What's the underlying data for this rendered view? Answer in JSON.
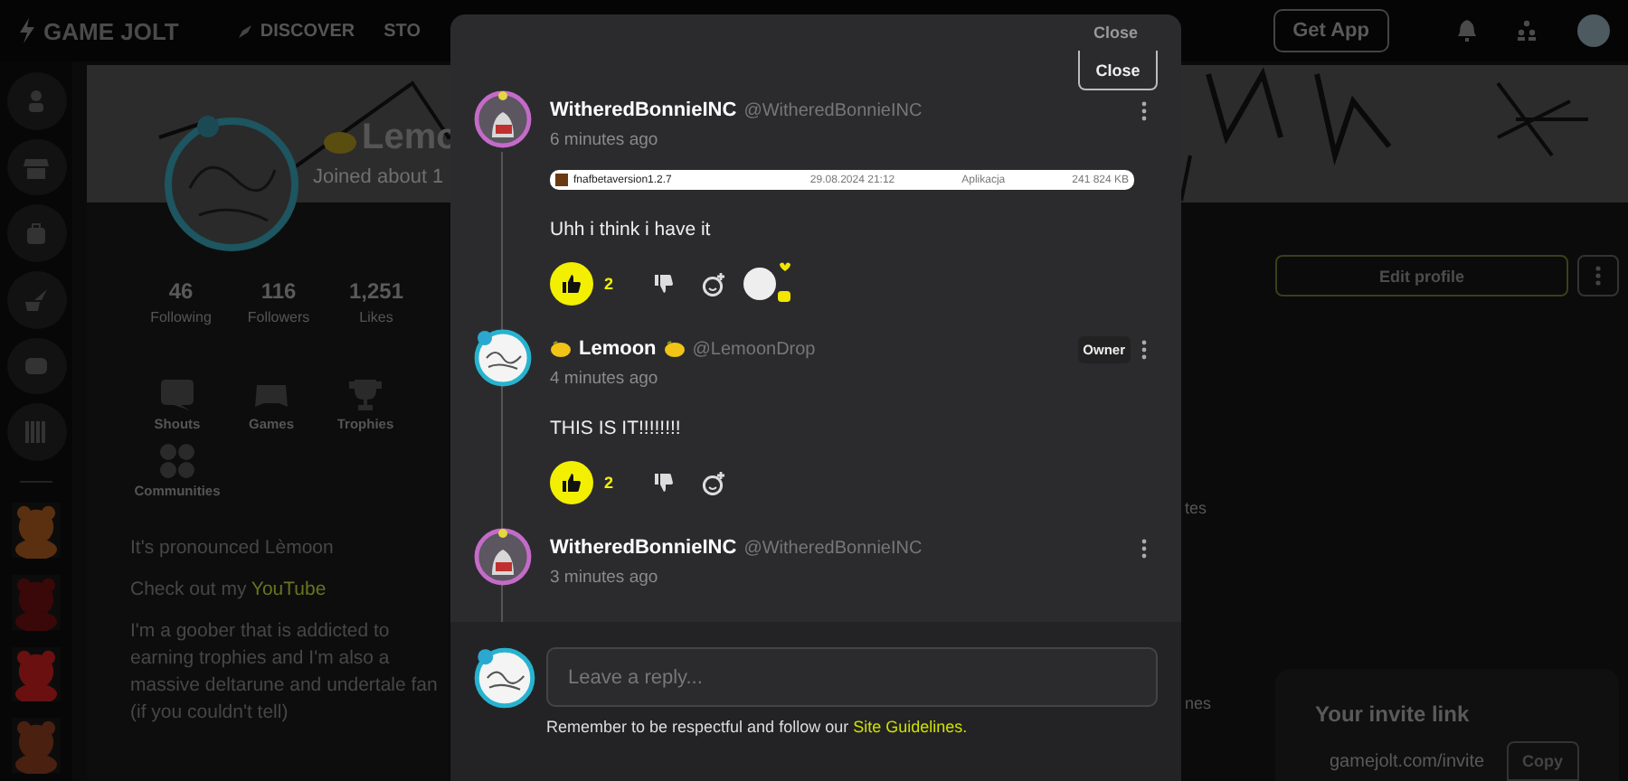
{
  "top_nav": {
    "logo": "GAME JOLT",
    "links": [
      "DISCOVER",
      "STO"
    ],
    "get_app": "Get App"
  },
  "profile": {
    "name": "Lemo",
    "joined": "Joined about 1",
    "stats": [
      {
        "value": "46",
        "label": "Following"
      },
      {
        "value": "116",
        "label": "Followers"
      },
      {
        "value": "1,251",
        "label": "Likes"
      }
    ],
    "sections": [
      {
        "kind": "shouts",
        "label": "Shouts"
      },
      {
        "kind": "games",
        "label": "Games"
      },
      {
        "kind": "trophies",
        "label": "Trophies"
      },
      {
        "kind": "communities",
        "label": "Communities"
      }
    ],
    "bio": [
      {
        "text": "It's pronounced Lèmoon"
      },
      {
        "text": "Check out my",
        "link": "YouTube"
      },
      {
        "text": "I'm a goober that is addicted to earning trophies and I'm also a massive deltarune and undertale fan (if you couldn't tell)"
      }
    ],
    "edit_button": "Edit profile"
  },
  "hidden_fragments": [
    "tes",
    "nes"
  ],
  "invite": {
    "title": "Your invite link",
    "url": "gamejolt.com/invite",
    "copy": "Copy"
  },
  "modal": {
    "close_labels": [
      "Close",
      "Close"
    ],
    "comments": [
      {
        "avatar": {
          "kind": "bonnie"
        },
        "author": "WitheredBonnieINC",
        "emoji": false,
        "handle": "@WitheredBonnieINC",
        "time": "6 minutes ago",
        "attachment": {
          "name": "fnafbetaversion1.2.7",
          "date": "29.08.2024 21:12",
          "type": "Aplikacja",
          "size": "241 824 KB"
        },
        "text": "Uhh i think i have it",
        "reactions": {
          "liked": true,
          "likes": "2",
          "reactor": true
        }
      },
      {
        "avatar": {
          "kind": "lemon"
        },
        "author": "Lemoon",
        "emoji": true,
        "handle": "@LemoonDrop",
        "badge": "Owner",
        "time": "4 minutes ago",
        "text": "THIS IS IT!!!!!!!!",
        "reactions": {
          "liked": true,
          "likes": "2",
          "reactor": false
        }
      },
      {
        "avatar": {
          "kind": "bonnie"
        },
        "author": "WitheredBonnieINC",
        "emoji": false,
        "handle": "@WitheredBonnieINC",
        "time": "3 minutes ago"
      }
    ],
    "reply": {
      "avatar": {
        "kind": "lemon"
      },
      "placeholder": "Leave a reply...",
      "notice": "Remember to be respectful and follow our",
      "link": "Site Guidelines."
    }
  }
}
